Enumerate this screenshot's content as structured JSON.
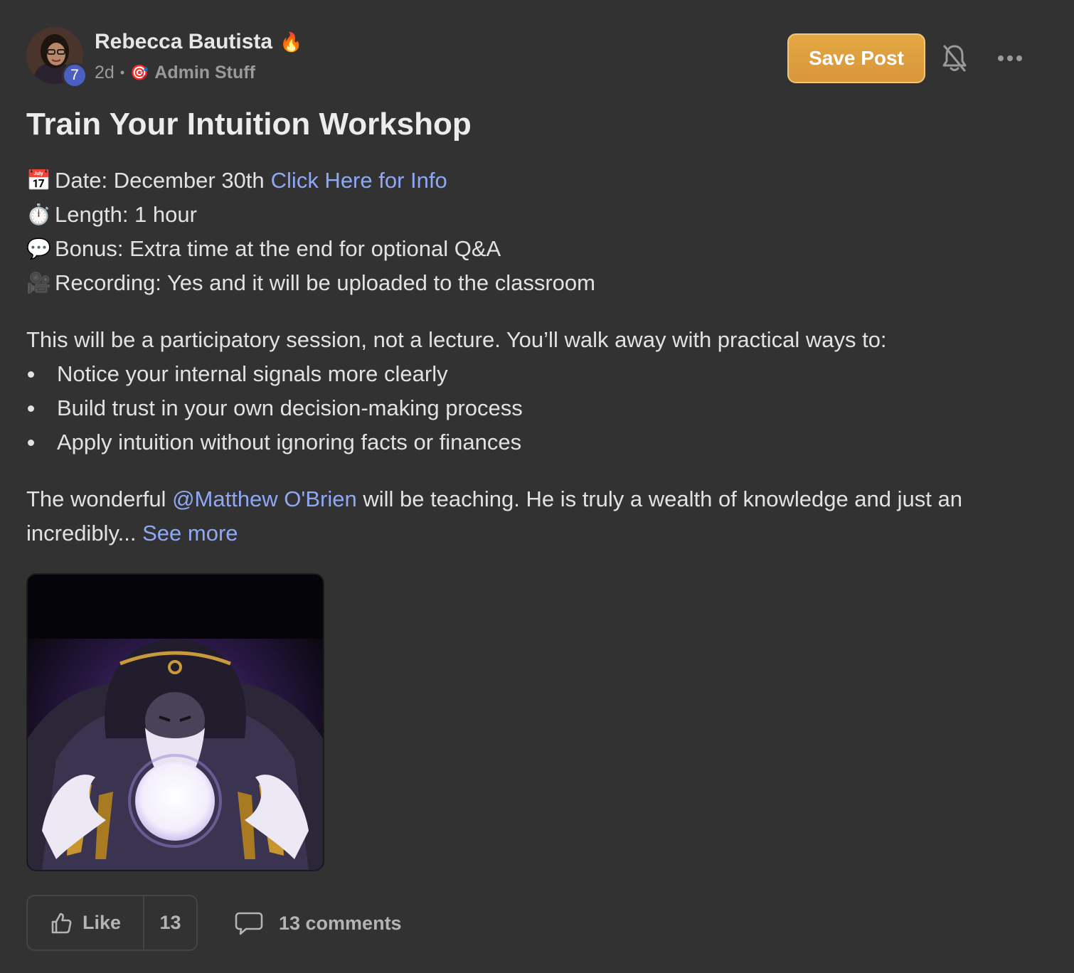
{
  "author": {
    "name": "Rebecca Bautista",
    "badge_emoji": "🔥",
    "level": "7",
    "avatar_icon": "user-avatar"
  },
  "meta": {
    "time_ago": "2d",
    "separator": "•",
    "category_emoji": "🎯",
    "category": "Admin Stuff"
  },
  "actions": {
    "save_label": "Save Post",
    "bell_icon": "bell-off-icon",
    "more_icon": "more-horizontal-icon"
  },
  "post": {
    "title": "Train Your Intuition Workshop",
    "details": [
      {
        "emoji": "📅",
        "text": "Date: December 30th ",
        "link": "Click Here for Info"
      },
      {
        "emoji": "⏱️",
        "text": "Length: 1 hour"
      },
      {
        "emoji": "💬",
        "text": "Bonus: Extra time at the end for optional Q&A"
      },
      {
        "emoji": "🎥",
        "text": "Recording: Yes and it will be uploaded to the classroom"
      }
    ],
    "intro": "This will be a participatory session, not a lecture. You’ll walk away with practical ways to:",
    "bullets": [
      "Notice your internal signals more clearly",
      "Build trust in your own decision-making process",
      "Apply intuition without ignoring facts or finances"
    ],
    "closing_pre": "The wonderful ",
    "mention": "@Matthew O'Brien",
    "closing_post": " will be teaching. He is truly a wealth of knowledge and just an incredibly... ",
    "see_more": "See more"
  },
  "footer": {
    "like_label": "Like",
    "like_count": "13",
    "comments_label": "13 comments"
  },
  "colors": {
    "background": "#323232",
    "accent_button": "#e4a843",
    "link": "#8fa8f5",
    "level_badge": "#4a5fc1"
  }
}
